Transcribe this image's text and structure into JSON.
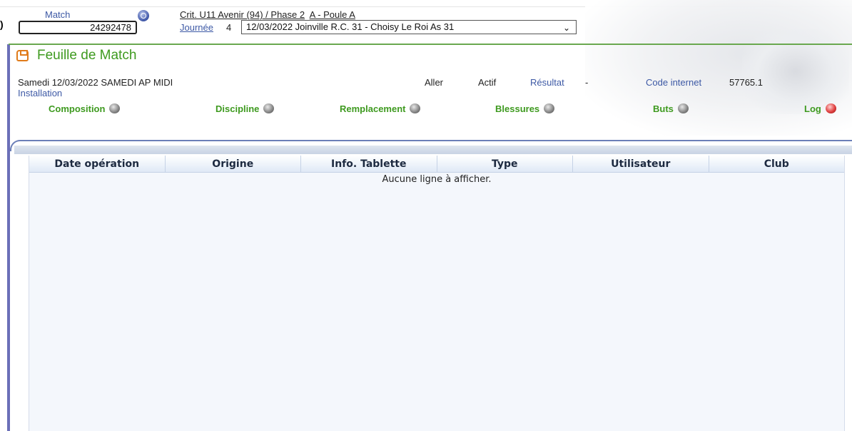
{
  "header": {
    "match_label": "Match",
    "match_number": "24292478",
    "competition": "Crit. U11 Avenir (94) / Phase 2",
    "poule": "A - Poule A",
    "journee_label": "Journée",
    "journee_number": "4",
    "selected_match": "12/03/2022 Joinville R.C. 31 - Choisy Le Roi As 31"
  },
  "page": {
    "title": "Feuille de Match",
    "date_info": "Samedi 12/03/2022 SAMEDI AP MIDI",
    "installation_label": "Installation",
    "aller": "Aller",
    "status": "Actif",
    "resultat_label": "Résultat",
    "resultat_value": "-",
    "code_label": "Code internet",
    "code_value": "57765.1"
  },
  "tabs": [
    {
      "label": "Composition",
      "active": false
    },
    {
      "label": "Discipline",
      "active": false
    },
    {
      "label": "Remplacement",
      "active": false
    },
    {
      "label": "Blessures",
      "active": false
    },
    {
      "label": "Buts",
      "active": false
    },
    {
      "label": "Log",
      "active": true
    }
  ],
  "grid": {
    "columns": [
      "Date opération",
      "Origine",
      "Info. Tablette",
      "Type",
      "Utilisateur",
      "Club"
    ],
    "empty_message": "Aucune ligne à afficher."
  },
  "colors": {
    "green": "#3e9a1f",
    "link_blue": "#3d59a5",
    "accent_orange": "#e07b1a"
  }
}
